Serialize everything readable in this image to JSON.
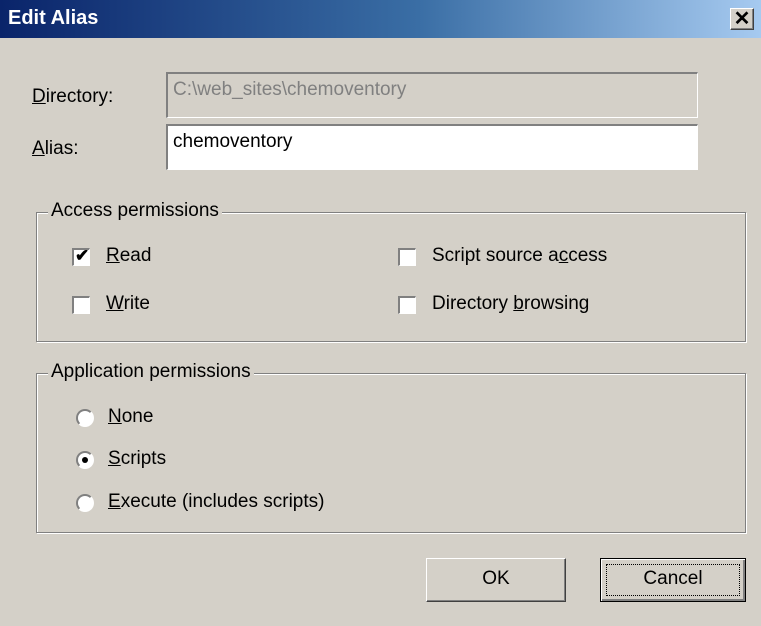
{
  "window": {
    "title": "Edit Alias",
    "close_glyph": "✕"
  },
  "fields": {
    "directory_label_accel": "D",
    "directory_label_rest": "irectory:",
    "directory_value": "C:\\web_sites\\chemoventory",
    "alias_label_accel": "A",
    "alias_label_rest": "lias:",
    "alias_value": "chemoventory"
  },
  "access_permissions": {
    "legend": "Access permissions",
    "read": {
      "pre": "",
      "accel": "R",
      "post": "ead",
      "checked": true
    },
    "write": {
      "pre": "",
      "accel": "W",
      "post": "rite",
      "checked": false
    },
    "script_source": {
      "pre": "Script source a",
      "accel": "c",
      "post": "cess",
      "checked": false
    },
    "dir_browsing": {
      "pre": "Directory ",
      "accel": "b",
      "post": "rowsing",
      "checked": false
    }
  },
  "application_permissions": {
    "legend": "Application permissions",
    "none": {
      "accel": "N",
      "post": "one",
      "selected": false
    },
    "scripts": {
      "accel": "S",
      "post": "cripts",
      "selected": true
    },
    "execute": {
      "accel": "E",
      "post": "xecute (includes scripts)",
      "selected": false
    }
  },
  "buttons": {
    "ok": "OK",
    "cancel": "Cancel"
  },
  "icons": {
    "check": "✔"
  }
}
